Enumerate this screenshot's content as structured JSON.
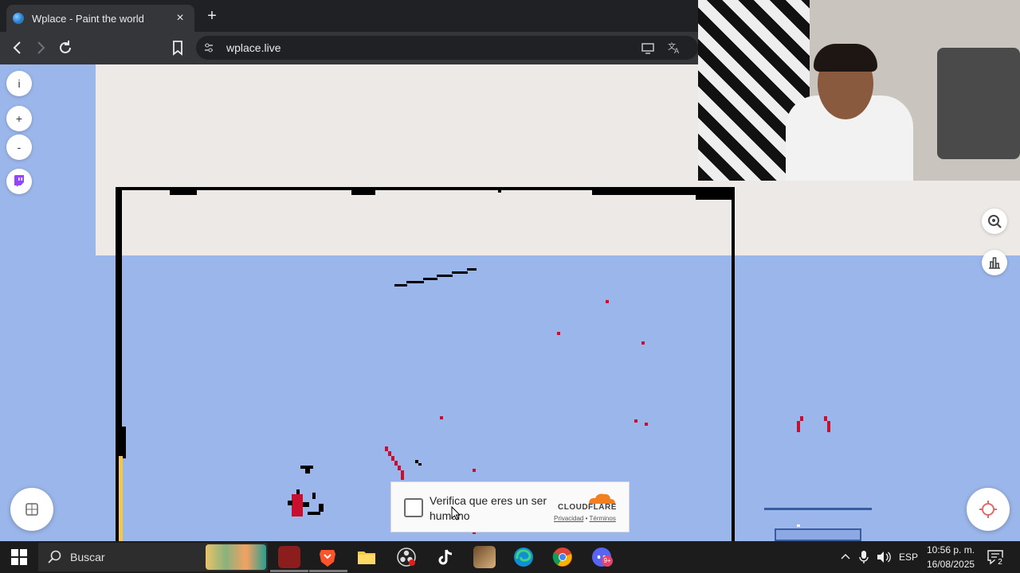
{
  "browser": {
    "tab": {
      "title": "Wplace - Paint the world",
      "close_glyph": "×",
      "favicon": "globe-favicon"
    },
    "new_tab_glyph": "+",
    "nav": {
      "back": "‹",
      "forward": "›",
      "reload": "⟳"
    },
    "bookmark_glyph": "🔖",
    "url": "wplace.live",
    "omnibox_icons": [
      "install-icon",
      "translate-icon"
    ]
  },
  "map_controls": {
    "info_label": "i",
    "zoom_in_label": "+",
    "zoom_out_label": "-",
    "twitch_icon": "twitch-icon",
    "right_icons": [
      "search-location-icon",
      "leaderboard-icon"
    ],
    "bottom_left": "palette-icon",
    "bottom_right": "locate-icon"
  },
  "captcha": {
    "text": "Verifica que eres un ser humano",
    "brand": "CLOUDFLARE",
    "privacy": "Privacidad",
    "separator": "•",
    "terms": "Términos"
  },
  "taskbar": {
    "search_placeholder": "Buscar",
    "apps": [
      "voicemeeter",
      "brave",
      "file-explorer",
      "obs",
      "tiktok",
      "game",
      "edge",
      "chrome",
      "discord"
    ],
    "discord_badge": "9+",
    "tray": {
      "language": "ESP",
      "time": "10:56 p. m.",
      "date": "16/08/2025",
      "notifications": "2"
    }
  },
  "colors": {
    "water": "#9bb6ea",
    "land": "#ece9e6",
    "pixel_red": "#c8102e",
    "pixel_black": "#000000"
  }
}
